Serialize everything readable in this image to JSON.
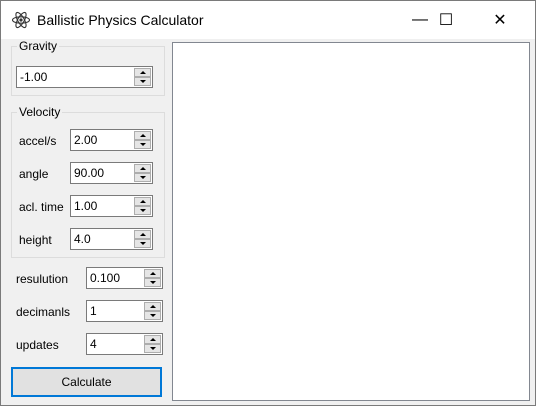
{
  "window": {
    "title": "Ballistic Physics Calculator",
    "icon": "atom-icon",
    "controls": {
      "minimize": "—",
      "maximize": "☐",
      "close": "✕"
    }
  },
  "gravity": {
    "legend": "Gravity",
    "value": "-1.00"
  },
  "velocity": {
    "legend": "Velocity",
    "fields": [
      {
        "label": "accel/s",
        "value": "2.00"
      },
      {
        "label": "angle",
        "value": "90.00"
      },
      {
        "label": "acl. time",
        "value": "1.00"
      },
      {
        "label": "height",
        "value": "4.0"
      }
    ]
  },
  "settings": [
    {
      "label": "resulution",
      "value": "0.100"
    },
    {
      "label": "decimanls",
      "value": "1"
    },
    {
      "label": "updates",
      "value": "4"
    }
  ],
  "calculate_label": "Calculate",
  "colors": {
    "focus_border": "#0078d7",
    "panel_bg": "#f0f0f0",
    "canvas_bg": "#ffffff"
  }
}
